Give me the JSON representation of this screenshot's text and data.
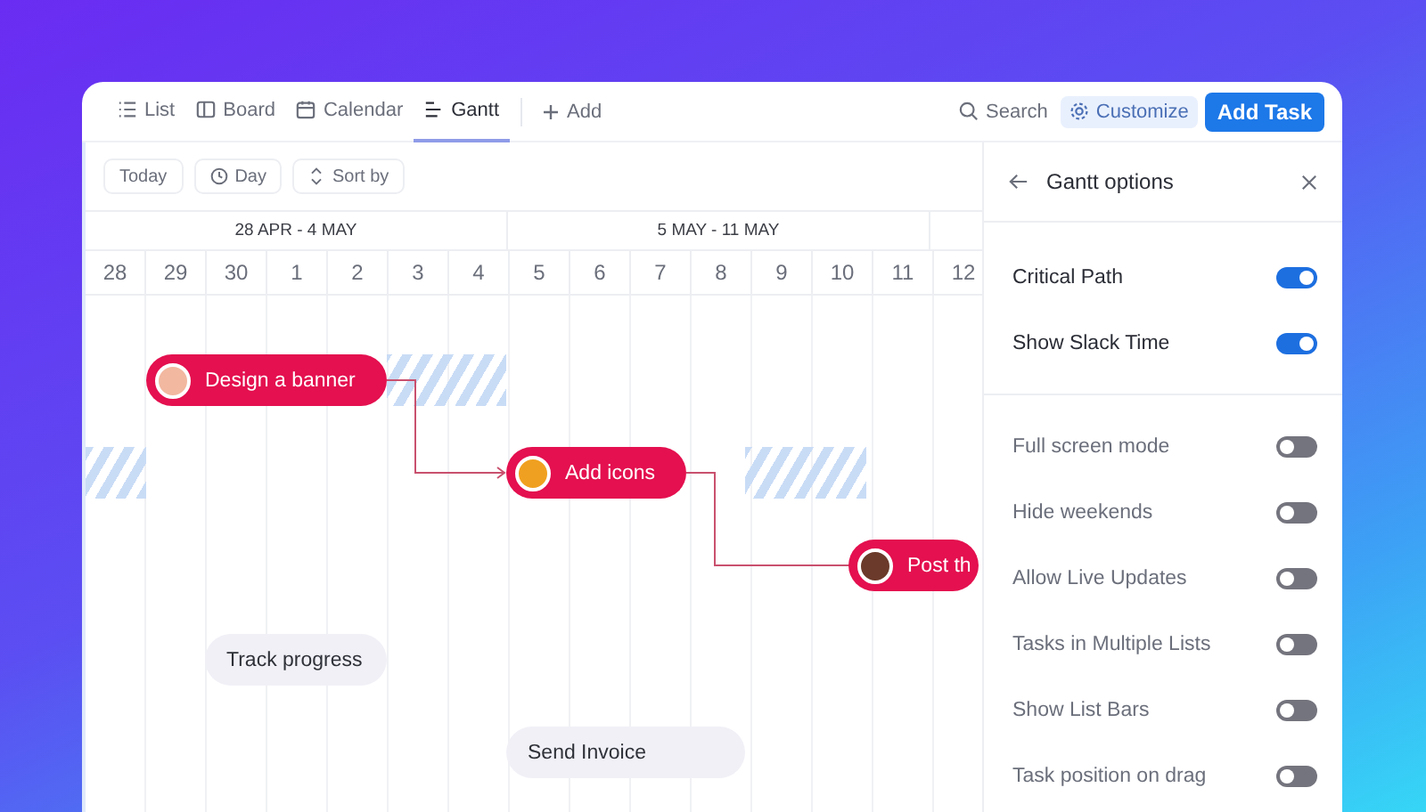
{
  "toolbar": {
    "views": [
      {
        "label": "List",
        "selected": false
      },
      {
        "label": "Board",
        "selected": false
      },
      {
        "label": "Calendar",
        "selected": false
      },
      {
        "label": "Gantt",
        "selected": true
      }
    ],
    "add_view": "Add",
    "search": "Search",
    "customize": "Customize",
    "add_task": "Add Task"
  },
  "controls": [
    {
      "label": "Today"
    },
    {
      "label": "Day"
    },
    {
      "label": "Sort by"
    }
  ],
  "weeks": [
    "28 APR - 4 MAY",
    "5 MAY - 11 MAY"
  ],
  "days": [
    "28",
    "29",
    "30",
    "1",
    "2",
    "3",
    "4",
    "5",
    "6",
    "7",
    "8",
    "9",
    "10",
    "11",
    "12"
  ],
  "tasks": [
    {
      "label": "Design a banner",
      "kind": "critical"
    },
    {
      "label": "Add icons",
      "kind": "critical"
    },
    {
      "label": "Post th",
      "kind": "critical"
    },
    {
      "label": "Track progress",
      "kind": "normal"
    },
    {
      "label": "Send Invoice",
      "kind": "normal"
    }
  ],
  "panel": {
    "title": "Gantt options",
    "primary_options": [
      {
        "label": "Critical Path",
        "on": true
      },
      {
        "label": "Show Slack Time",
        "on": true
      }
    ],
    "options": [
      {
        "label": "Full screen mode",
        "on": false
      },
      {
        "label": "Hide weekends",
        "on": false
      },
      {
        "label": "Allow Live Updates",
        "on": false
      },
      {
        "label": "Tasks in Multiple Lists",
        "on": false
      },
      {
        "label": "Show List Bars",
        "on": false
      },
      {
        "label": "Task position on drag",
        "on": false
      }
    ]
  }
}
